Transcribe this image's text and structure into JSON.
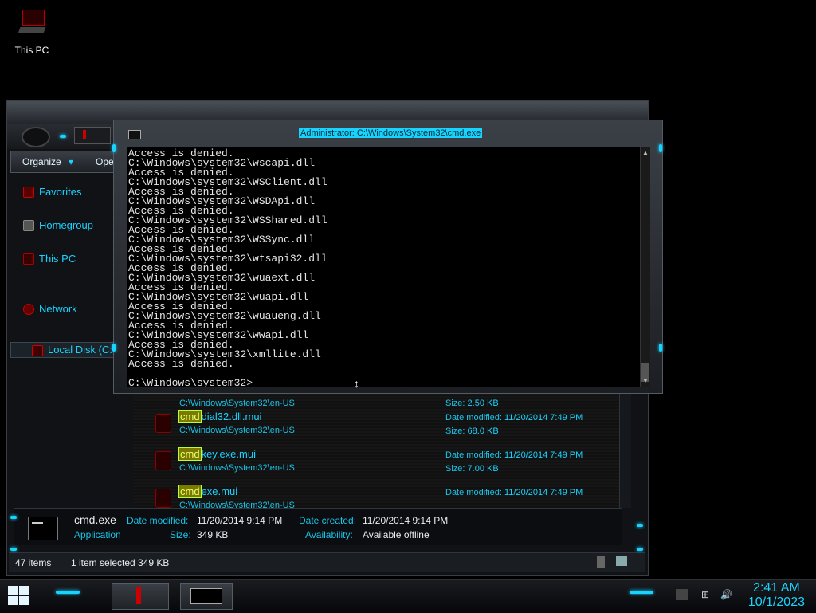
{
  "desktop": {
    "icon_label": "This PC"
  },
  "explorer": {
    "toolbar": {
      "organize": "Organize",
      "open": "Ope"
    },
    "nav": {
      "favorites": "Favorites",
      "homegroup": "Homegroup",
      "this_pc": "This PC",
      "local_disk": "Local Disk (C:",
      "network": "Network"
    },
    "files": [
      {
        "prefix": "cmd",
        "rest": "dial32.dll.mui",
        "path": "C:\\Windows\\System32\\en-US",
        "date_label": "Date modified:",
        "date": "11/20/2014 7:49 PM",
        "size_label": "Size:",
        "size": "68.0 KB"
      },
      {
        "prefix": "cmd",
        "rest": "key.exe.mui",
        "path": "C:\\Windows\\System32\\en-US",
        "date_label": "Date modified:",
        "date": "11/20/2014 7:49 PM",
        "size_label": "Size:",
        "size": "7.00 KB"
      },
      {
        "prefix": "cmd",
        "rest": "exe.mui",
        "path": "C:\\Windows\\System32\\en-US",
        "date_label": "Date modified:",
        "date": "11/20/2014 7:49 PM",
        "size_label": "Size:",
        "size": ""
      }
    ],
    "partial_row": {
      "path": "C:\\Windows\\System32\\en-US",
      "size_label": "Size:",
      "size": "2.50 KB"
    },
    "details": {
      "name": "cmd.exe",
      "type": "Application",
      "date_modified_label": "Date modified:",
      "date_modified": "11/20/2014 9:14 PM",
      "size_label": "Size:",
      "size": "349 KB",
      "date_created_label": "Date created:",
      "date_created": "11/20/2014 9:14 PM",
      "availability_label": "Availability:",
      "availability": "Available offline"
    },
    "status": {
      "items": "47 items",
      "selected": "1 item selected  349 KB"
    }
  },
  "cmd": {
    "title": "Administrator: C:\\Windows\\System32\\cmd.exe",
    "lines": [
      "Access is denied.",
      "C:\\Windows\\system32\\wscapi.dll",
      "Access is denied.",
      "C:\\Windows\\system32\\WSClient.dll",
      "Access is denied.",
      "C:\\Windows\\system32\\WSDApi.dll",
      "Access is denied.",
      "C:\\Windows\\system32\\WSShared.dll",
      "Access is denied.",
      "C:\\Windows\\system32\\WSSync.dll",
      "Access is denied.",
      "C:\\Windows\\system32\\wtsapi32.dll",
      "Access is denied.",
      "C:\\Windows\\system32\\wuaext.dll",
      "Access is denied.",
      "C:\\Windows\\system32\\wuapi.dll",
      "Access is denied.",
      "C:\\Windows\\system32\\wuaueng.dll",
      "Access is denied.",
      "C:\\Windows\\system32\\wwapi.dll",
      "Access is denied.",
      "C:\\Windows\\system32\\xmllite.dll",
      "Access is denied.",
      "",
      "C:\\Windows\\system32>"
    ]
  },
  "taskbar": {
    "time": "2:41 AM",
    "date": "10/1/2023"
  },
  "colors": {
    "accent": "#19d3ff",
    "highlight": "#b8ff3a",
    "brand_red": "#8b0000"
  }
}
